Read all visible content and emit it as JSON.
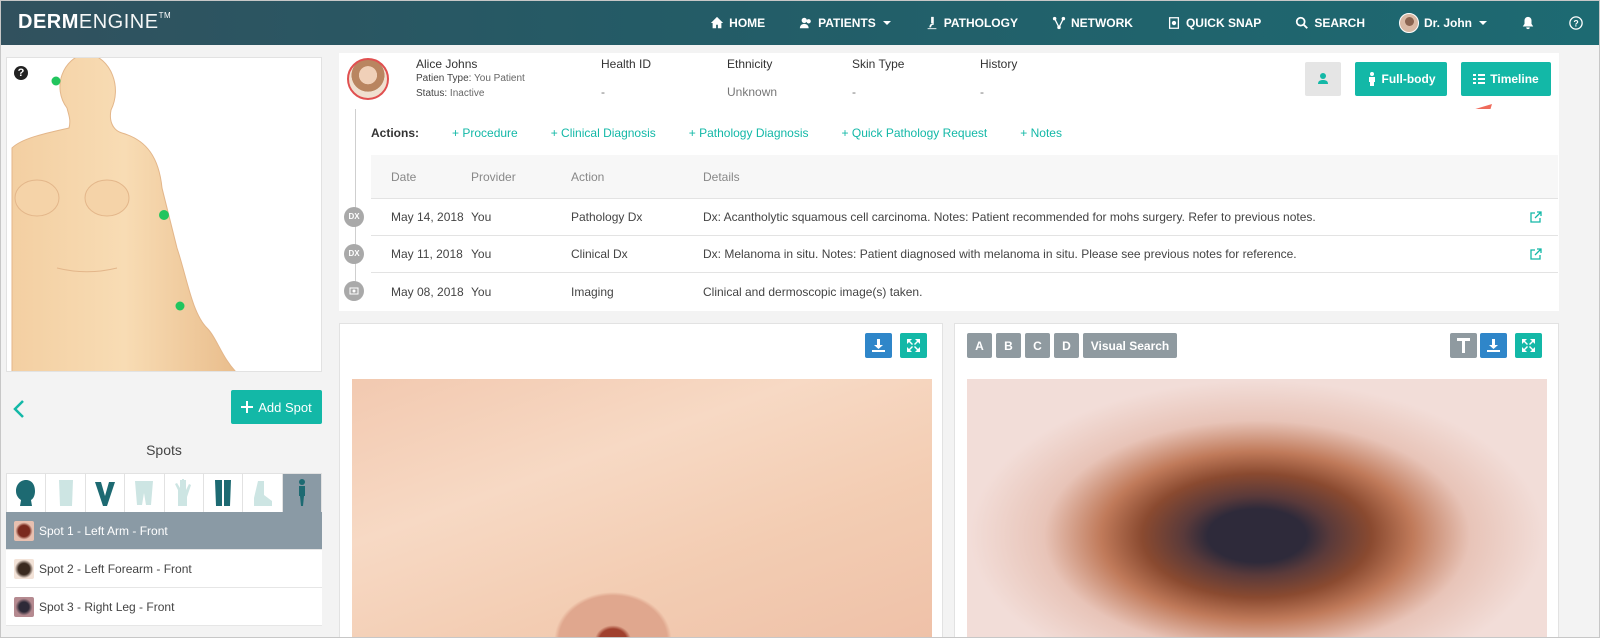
{
  "nav": {
    "logo_bold": "DERM",
    "logo_light": "ENGINE",
    "logo_tm": "TM",
    "items": [
      {
        "label": "HOME",
        "icon": "home-icon"
      },
      {
        "label": "PATIENTS",
        "icon": "patients-icon"
      },
      {
        "label": "PATHOLOGY",
        "icon": "microscope-icon"
      },
      {
        "label": "NETWORK",
        "icon": "network-icon"
      },
      {
        "label": "QUICK SNAP",
        "icon": "camera-icon"
      },
      {
        "label": "SEARCH",
        "icon": "search-icon"
      }
    ],
    "user": "Dr. John"
  },
  "left": {
    "help": "?",
    "add_spot": "Add Spot",
    "spots_title": "Spots",
    "spots": [
      {
        "label": "Spot 1 - Left Arm - Front"
      },
      {
        "label": "Spot 2 - Left Forearm - Front"
      },
      {
        "label": "Spot 3 - Right Leg - Front"
      }
    ]
  },
  "patient": {
    "name": "Alice Johns",
    "type_label": "Patien Type:",
    "type_value": "You Patient",
    "status_label": "Status:",
    "status_value": "Inactive",
    "fields": [
      {
        "label": "Health ID",
        "value": "-"
      },
      {
        "label": "Ethnicity",
        "value": "Unknown"
      },
      {
        "label": "Skin Type",
        "value": "-"
      },
      {
        "label": "History",
        "value": "-"
      }
    ],
    "fullbody": "Full-body",
    "timeline": "Timeline"
  },
  "actions": {
    "label": "Actions:",
    "links": [
      "+ Procedure",
      "+ Clinical Diagnosis",
      "+ Pathology Diagnosis",
      "+ Quick Pathology Request",
      "+ Notes"
    ]
  },
  "table": {
    "headers": [
      "Date",
      "Provider",
      "Action",
      "Details"
    ],
    "rows": [
      {
        "badge": "DX",
        "date": "May 14, 2018",
        "provider": "You",
        "action": "Pathology Dx",
        "details": "Dx: Acantholytic squamous cell carcinoma. Notes: Patient recommended for mohs surgery. Refer to previous notes.",
        "link": true
      },
      {
        "badge": "DX",
        "date": "May 11, 2018",
        "provider": "You",
        "action": "Clinical Dx",
        "details": "Dx: Melanoma in situ. Notes: Patient diagnosed with melanoma in situ. Please see previous notes for reference.",
        "link": true
      },
      {
        "badge": "",
        "date": "May 08, 2018",
        "provider": "You",
        "action": "Imaging",
        "details": "Clinical and dermoscopic image(s) taken.",
        "link": false
      }
    ]
  },
  "viewer": {
    "letters": [
      "A",
      "B",
      "C",
      "D"
    ],
    "visual_search": "Visual Search"
  },
  "colors": {
    "accent": "#13b8a7",
    "blue": "#2f86c9",
    "nav": "#245b66",
    "marker": "#22c55e"
  }
}
